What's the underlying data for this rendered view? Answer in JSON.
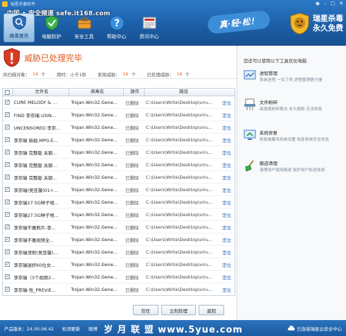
{
  "window": {
    "title": "瑞星杀毒软件",
    "controls": [
      "shirt",
      "min",
      "max",
      "close"
    ]
  },
  "watermark": "中国 • 安全频道 safe.it168.com",
  "nav": [
    {
      "label": "病毒查杀",
      "icon": "shield-scan-icon",
      "active": true
    },
    {
      "label": "电脑防护",
      "icon": "green-shield-icon",
      "active": false
    },
    {
      "label": "安全工具",
      "icon": "toolbox-icon",
      "active": false
    },
    {
      "label": "帮助中心",
      "icon": "help-icon",
      "active": false
    },
    {
      "label": "资讯中心",
      "icon": "news-icon",
      "active": false
    }
  ],
  "slogan": "真·轻·松！",
  "brand": {
    "line1": "瑞星杀毒",
    "line2": "永久免费"
  },
  "status": {
    "title": "威胁已处理完毕",
    "scanned_label": "共扫描对象：",
    "scanned_value": "16",
    "scanned_unit": "个",
    "time_label": "用时：",
    "time_value": "小于1秒",
    "found_label": "发现威胁：",
    "found_value": "16",
    "found_unit": "个",
    "handled_label": "已处理威胁：",
    "handled_value": "16",
    "handled_unit": "个"
  },
  "table": {
    "headers": {
      "file": "文件名",
      "virus": "病毒名",
      "op": "操作",
      "path": "路径"
    },
    "rows": [
      {
        "file": "CURE MELODY & ...",
        "virus": "Trojan.Win32.Gene...",
        "op": "已删除",
        "path": "C:\\Users\\Write\\Desktop\\viru...",
        "loc": "定位"
      },
      {
        "file": "FIND 李奈瑞 USIN...",
        "virus": "Trojan.Win32.Gene...",
        "op": "已删除",
        "path": "C:\\Users\\Write\\Desktop\\viru...",
        "loc": "定位"
      },
      {
        "file": "UNCENSORED 李奈...",
        "virus": "Trojan.Win32.Gene...",
        "op": "已删除",
        "path": "C:\\Users\\Write\\Desktop\\viru...",
        "loc": "定位"
      },
      {
        "file": "李奈瑞 偷拍.MPG.E...",
        "virus": "Trojan.Win32.Gene...",
        "op": "已删除",
        "path": "C:\\Users\\Write\\Desktop\\viru...",
        "loc": "定位"
      },
      {
        "file": "李奈瑞 完整版 关颖...",
        "virus": "Trojan.Win32.Gene...",
        "op": "已删除",
        "path": "C:\\Users\\Write\\Desktop\\viru...",
        "loc": "定位"
      },
      {
        "file": "李奈瑞 完整版 关颖...",
        "virus": "Trojan.Win32.Gene...",
        "op": "已删除",
        "path": "C:\\Users\\Write\\Desktop\\viru...",
        "loc": "定位"
      },
      {
        "file": "李奈瑞 完整版 关颖...",
        "virus": "Trojan.Win32.Gene...",
        "op": "已删除",
        "path": "C:\\Users\\Write\\Desktop\\viru...",
        "loc": "定位"
      },
      {
        "file": "李奈瑞(吴亚馨)01+...",
        "virus": "Trojan.Win32.Gene...",
        "op": "已删除",
        "path": "C:\\Users\\Write\\Desktop\\viru...",
        "loc": "定位"
      },
      {
        "file": "李奈瑞27.5G种子地...",
        "virus": "Trojan.Win32.Gene...",
        "op": "已删除",
        "path": "C:\\Users\\Write\\Desktop\\viru...",
        "loc": "定位"
      },
      {
        "file": "李奈瑞27.5G种子地...",
        "virus": "Trojan.Win32.Gene...",
        "op": "已删除",
        "path": "C:\\Users\\Write\\Desktop\\viru...",
        "loc": "定位"
      },
      {
        "file": "李奈瑞不雅照片-李...",
        "virus": "Trojan.Win32.Gene...",
        "op": "已删除",
        "path": "C:\\Users\\Write\\Desktop\\viru...",
        "loc": "定位"
      },
      {
        "file": "李奈瑞不雅视频全...",
        "virus": "Trojan.Win32.Gene...",
        "op": "已删除",
        "path": "C:\\Users\\Write\\Desktop\\viru...",
        "loc": "定位"
      },
      {
        "file": "李奈瑞泄照(吴亚馨)...",
        "virus": "Trojan.Win32.Gene...",
        "op": "已删除",
        "path": "C:\\Users\\Write\\Desktop\\viru...",
        "loc": "定位"
      },
      {
        "file": "李奈瑞迷奸60位女...",
        "virus": "Trojan.Win32.Gene...",
        "op": "已删除",
        "path": "C:\\Users\\Write\\Desktop\\viru...",
        "loc": "定位"
      },
      {
        "file": "李奈瑞（3个视频2...",
        "virus": "Trojan.Win32.Gene...",
        "op": "已删除",
        "path": "C:\\Users\\Write\\Desktop\\viru...",
        "loc": "定位"
      },
      {
        "file": "李奈瑞-性_PREVIE...",
        "virus": "Trojan.Win32.Gene...",
        "op": "已删除",
        "path": "C:\\Users\\Write\\Desktop\\viru...",
        "loc": "定位"
      }
    ]
  },
  "buttons": {
    "trust": "信任",
    "handle_now": "立刻处理",
    "back": "返回"
  },
  "right": {
    "title": "您还可以使用以下工具优化电脑",
    "tools": [
      {
        "name": "进程管理",
        "desc": "系统进程 一目了然 进程管理更方便",
        "icon": "process-icon"
      },
      {
        "name": "文件粉碎",
        "desc": "高强度粉碎算法 永久删除 无法恢复",
        "icon": "shredder-icon"
      },
      {
        "name": "系统修复",
        "desc": "修复被篡改系统设置 恢复系统安全状态",
        "icon": "repair-icon"
      },
      {
        "name": "痕迹清理",
        "desc": "清理用户使用痕迹 保护用户私密信息",
        "icon": "broom-icon"
      }
    ]
  },
  "footer": {
    "version": "产品版本：24.00.06.42",
    "check_update": "检测更新",
    "weibo": "微博",
    "site": "岁 月 联 盟   www.5yue.com",
    "cloud": "已连接瑞星云安全中心"
  },
  "colors": {
    "accent": "#1d5fa8",
    "warning": "#e05a1a",
    "link": "#1c64b8"
  }
}
